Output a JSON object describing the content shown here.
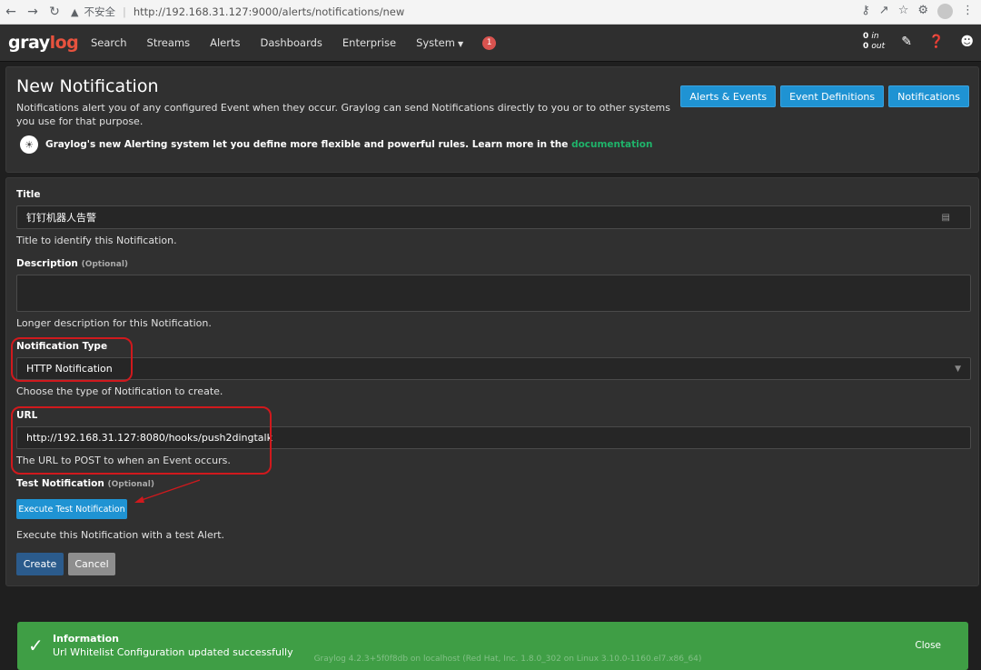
{
  "browser": {
    "insecure_label": "不安全",
    "url": "http://192.168.31.127:9000/alerts/notifications/new"
  },
  "navbar": {
    "logo_main": "gray",
    "logo_accent": "log",
    "items": [
      "Search",
      "Streams",
      "Alerts",
      "Dashboards",
      "Enterprise",
      "System"
    ],
    "badge_count": "1",
    "throughput_in": "0",
    "throughput_in_label": "in",
    "throughput_out": "0",
    "throughput_out_label": "out"
  },
  "page": {
    "title": "New Notification",
    "description": "Notifications alert you of any configured Event when they occur. Graylog can send Notifications directly to you or to other systems you use for that purpose.",
    "buttons": [
      "Alerts & Events",
      "Event Definitions",
      "Notifications"
    ],
    "tip_text": "Graylog's new Alerting system let you define more flexible and powerful rules. Learn more in the",
    "tip_link": "documentation"
  },
  "form": {
    "title_label": "Title",
    "title_value": "钉钉机器人告警",
    "title_help": "Title to identify this Notification.",
    "description_label": "Description",
    "optional_label": "(Optional)",
    "description_value": "",
    "description_help": "Longer description for this Notification.",
    "type_label": "Notification Type",
    "type_value": "HTTP Notification",
    "type_help": "Choose the type of Notification to create.",
    "url_label": "URL",
    "url_value": "http://192.168.31.127:8080/hooks/push2dingtalk",
    "url_help": "The URL to POST to when an Event occurs.",
    "test_label": "Test Notification",
    "test_button": "Execute Test Notification",
    "test_help": "Execute this Notification with a test Alert.",
    "create_button": "Create",
    "cancel_button": "Cancel"
  },
  "toast": {
    "title": "Information",
    "message": "Url Whitelist Configuration updated successfully",
    "close": "Close"
  },
  "footer": {
    "text": "Graylog 4.2.3+5f0f8db on localhost (Red Hat, Inc. 1.8.0_302 on Linux 3.10.0-1160.el7.x86_64)"
  }
}
